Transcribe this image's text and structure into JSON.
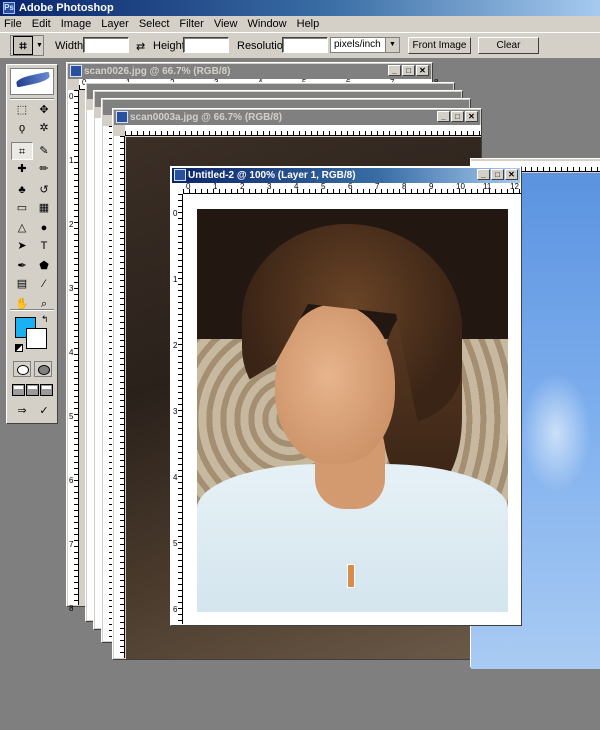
{
  "app": {
    "title": "Adobe Photoshop",
    "logo_text": "Ps"
  },
  "menu": [
    "File",
    "Edit",
    "Image",
    "Layer",
    "Select",
    "Filter",
    "View",
    "Window",
    "Help"
  ],
  "options_bar": {
    "width_label": "Width:",
    "height_label": "Height:",
    "resolution_label": "Resolution:",
    "units_value": "pixels/inch",
    "front_image_label": "Front Image",
    "clear_label": "Clear"
  },
  "toolbox": {
    "tools": [
      {
        "name": "marquee-tool",
        "glyph": "⬚"
      },
      {
        "name": "move-tool",
        "glyph": "✥"
      },
      {
        "name": "lasso-tool",
        "glyph": "ϙ"
      },
      {
        "name": "magic-wand-tool",
        "glyph": "✲"
      },
      {
        "name": "crop-tool",
        "glyph": "⌗"
      },
      {
        "name": "slice-tool",
        "glyph": "✎"
      },
      {
        "name": "healing-brush-tool",
        "glyph": "✚"
      },
      {
        "name": "brush-tool",
        "glyph": "✏"
      },
      {
        "name": "clone-stamp-tool",
        "glyph": "♣"
      },
      {
        "name": "history-brush-tool",
        "glyph": "↺"
      },
      {
        "name": "eraser-tool",
        "glyph": "▭"
      },
      {
        "name": "gradient-tool",
        "glyph": "▦"
      },
      {
        "name": "blur-tool",
        "glyph": "△"
      },
      {
        "name": "dodge-tool",
        "glyph": "●"
      },
      {
        "name": "path-select-tool",
        "glyph": "➤"
      },
      {
        "name": "type-tool",
        "glyph": "T"
      },
      {
        "name": "pen-tool",
        "glyph": "✒"
      },
      {
        "name": "shape-tool",
        "glyph": "⬟"
      },
      {
        "name": "notes-tool",
        "glyph": "▤"
      },
      {
        "name": "eyedropper-tool",
        "glyph": "⁄"
      },
      {
        "name": "hand-tool",
        "glyph": "✋"
      },
      {
        "name": "zoom-tool",
        "glyph": "⌕"
      }
    ],
    "foreground_color": "#1ab0f2",
    "background_color": "#ffffff"
  },
  "windows": {
    "scan0026": {
      "title": "scan0026.jpg @ 66.7% (RGB/8)"
    },
    "scan0003a": {
      "title": "scan0003a.jpg @ 66.7% (RGB/8)"
    },
    "untitled2": {
      "title": "Untitled-2 @ 100% (Layer 1, RGB/8)"
    }
  },
  "ruler_numbers": {
    "back_h": [
      "0",
      "1",
      "2",
      "3",
      "4",
      "5",
      "6",
      "7",
      "8"
    ],
    "front_h": [
      "0",
      "1",
      "2",
      "3",
      "4",
      "5",
      "6",
      "7",
      "8",
      "9",
      "10",
      "11",
      "12"
    ],
    "front_v": [
      "0",
      "1",
      "2",
      "3",
      "4",
      "5",
      "6"
    ],
    "back_v": [
      "0",
      "1",
      "2",
      "3",
      "4",
      "5",
      "6",
      "7",
      "8"
    ]
  }
}
